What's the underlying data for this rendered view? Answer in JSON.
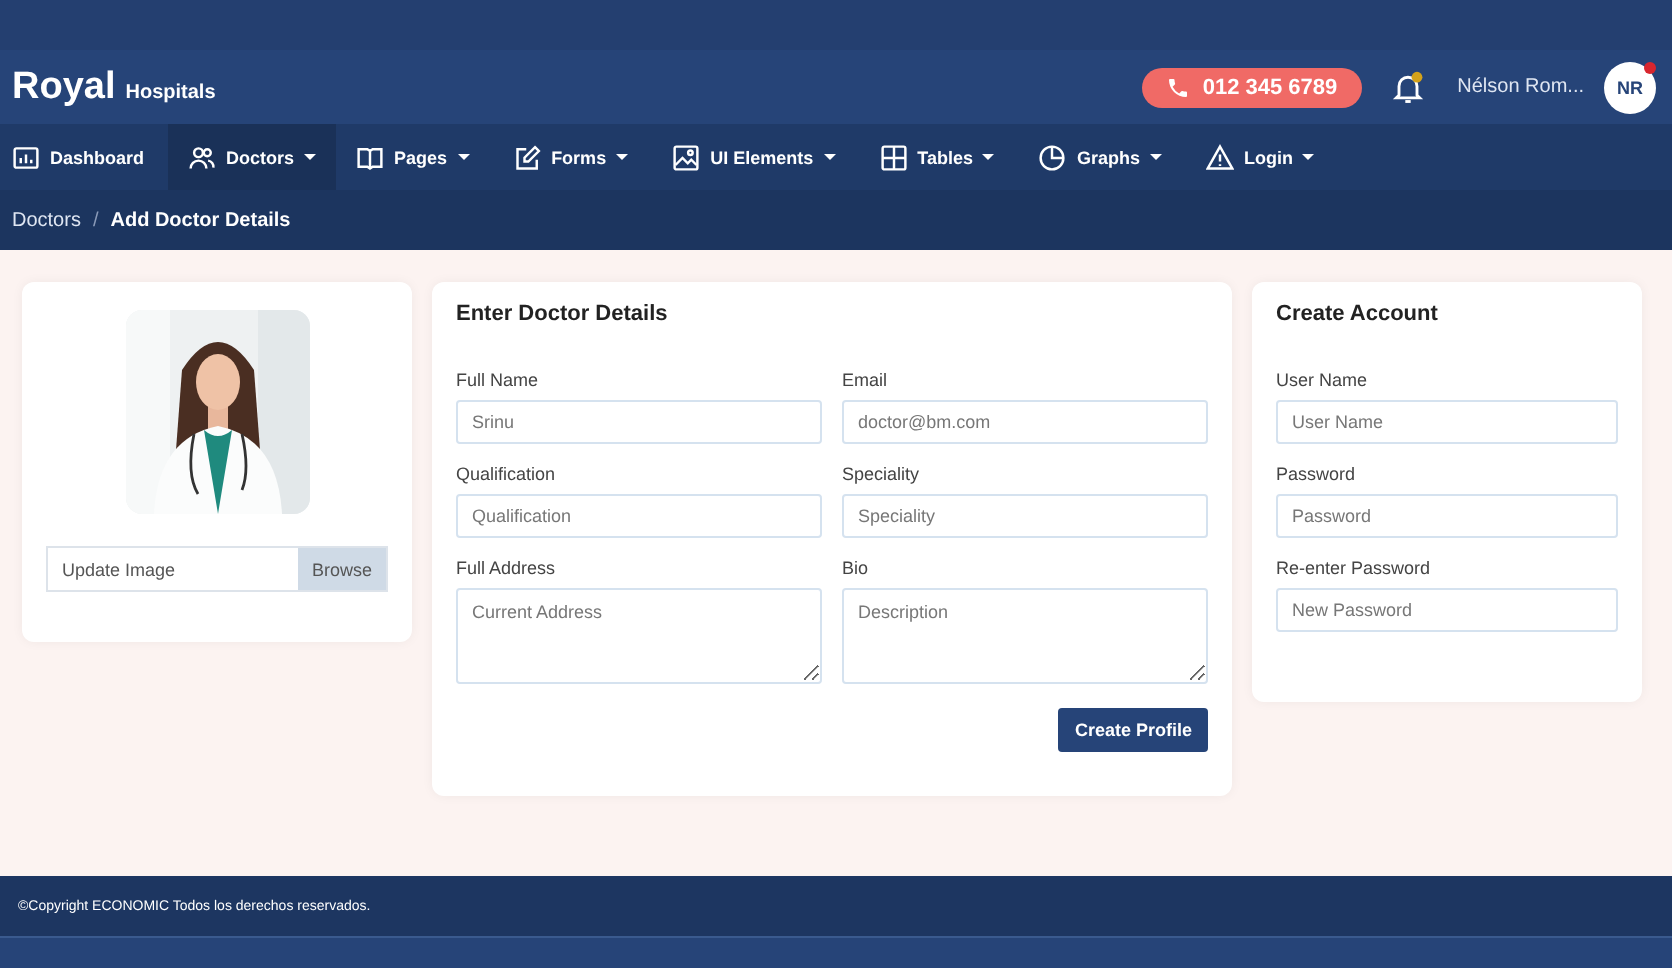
{
  "brand": {
    "name": "Royal",
    "sub": "Hospitals"
  },
  "header": {
    "phone": "012 345 6789",
    "user_name": "Nélson Rom...",
    "avatar": "NR"
  },
  "nav": [
    {
      "label": "Dashboard",
      "selected": false,
      "dropdown": false
    },
    {
      "label": "Doctors",
      "selected": true,
      "dropdown": true
    },
    {
      "label": "Pages",
      "selected": false,
      "dropdown": true
    },
    {
      "label": "Forms",
      "selected": false,
      "dropdown": true
    },
    {
      "label": "UI Elements",
      "selected": false,
      "dropdown": true
    },
    {
      "label": "Tables",
      "selected": false,
      "dropdown": true
    },
    {
      "label": "Graphs",
      "selected": false,
      "dropdown": true
    },
    {
      "label": "Login",
      "selected": false,
      "dropdown": true
    }
  ],
  "breadcrumb": [
    {
      "label": "Doctors"
    },
    {
      "separator": "/",
      "label": "Add Doctor Details"
    }
  ],
  "photo_card": {
    "file": {
      "placeholder": "Update Image",
      "button": "Browse"
    }
  },
  "details": {
    "title": "Enter Doctor Details",
    "fields": [
      {
        "label": "Full Name",
        "placeholder": "Srinu",
        "kind": "input"
      },
      {
        "label": "Email",
        "placeholder": "doctor@bm.com",
        "kind": "input"
      },
      {
        "label": "Qualification",
        "placeholder": "Qualification",
        "kind": "input"
      },
      {
        "label": "Speciality",
        "placeholder": "Speciality",
        "kind": "input"
      },
      {
        "label": "Full Address",
        "placeholder": "Current Address",
        "kind": "textarea"
      },
      {
        "label": "Bio",
        "placeholder": "Description",
        "kind": "textarea"
      }
    ],
    "button": "Create Profile"
  },
  "account": {
    "title": "Create Account",
    "fields": [
      {
        "label": "User Name",
        "placeholder": "User Name"
      },
      {
        "label": "Password",
        "placeholder": "Password"
      },
      {
        "label": "Re-enter Password",
        "placeholder": "New Password"
      }
    ]
  },
  "footer": {
    "text": "©Copyright ECONOMIC Todos los derechos reservados."
  }
}
